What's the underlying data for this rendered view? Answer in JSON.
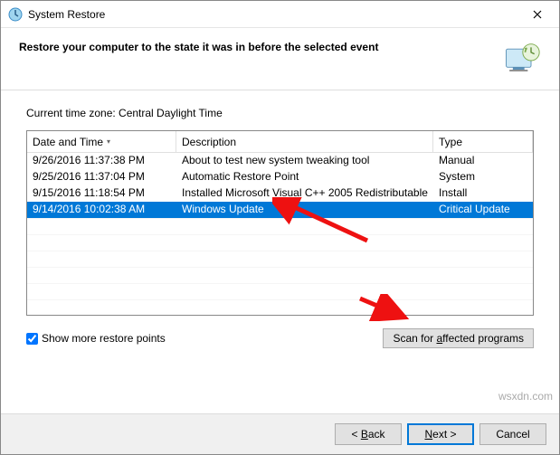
{
  "titlebar": {
    "title": "System Restore"
  },
  "header": {
    "text": "Restore your computer to the state it was in before the selected event"
  },
  "timezone_label": "Current time zone: Central Daylight Time",
  "columns": {
    "date": "Date and Time",
    "desc": "Description",
    "type": "Type"
  },
  "restore_points": [
    {
      "date": "9/26/2016 11:37:38 PM",
      "desc": "About to test new system tweaking tool",
      "type": "Manual",
      "selected": false
    },
    {
      "date": "9/25/2016 11:37:04 PM",
      "desc": "Automatic Restore Point",
      "type": "System",
      "selected": false
    },
    {
      "date": "9/15/2016 11:18:54 PM",
      "desc": "Installed Microsoft Visual C++ 2005 Redistributable",
      "type": "Install",
      "selected": false
    },
    {
      "date": "9/14/2016 10:02:38 AM",
      "desc": "Windows Update",
      "type": "Critical Update",
      "selected": true
    }
  ],
  "show_more": {
    "checked": true,
    "label": "Show more restore points"
  },
  "scan_button_label": "Scan for affected programs",
  "buttons": {
    "back": "< Back",
    "next": "Next >",
    "cancel": "Cancel"
  },
  "watermark": "wsxdn.com"
}
